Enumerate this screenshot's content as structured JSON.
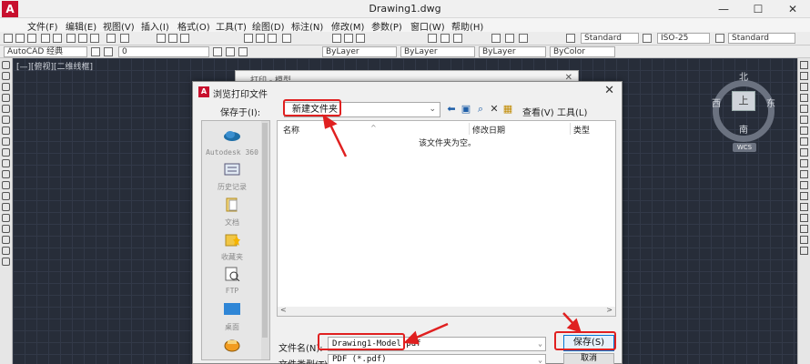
{
  "window": {
    "title": "Drawing1.dwg",
    "logo": "A",
    "minimize": "—",
    "maximize": "☐",
    "close": "✕"
  },
  "menu": [
    "文件(F)",
    "编辑(E)",
    "视图(V)",
    "插入(I)",
    "格式(O)",
    "工具(T)",
    "绘图(D)",
    "标注(N)",
    "修改(M)",
    "参数(P)",
    "窗口(W)",
    "帮助(H)"
  ],
  "toolbar": {
    "text_style": "Standard",
    "dim_style": "ISO-25",
    "table_style": "Standard",
    "workspace": "AutoCAD 经典",
    "layer_value": "0",
    "color": "ByLayer",
    "linetype": "ByLayer",
    "lineweight": "ByLayer",
    "plotstyle": "ByColor"
  },
  "viewport_label": "[—][俯视][二维线框]",
  "viewcube": {
    "top": "上",
    "north": "北",
    "south": "南",
    "east": "东",
    "west": "西",
    "wcs": "WCS"
  },
  "bg_dialog": {
    "title": "打印 - 模型",
    "close": "✕"
  },
  "dialog": {
    "title": "浏览打印文件",
    "close": "✕",
    "save_in_label": "保存于(I):",
    "save_in_value": "新建文件夹",
    "view_menu": "查看(V)",
    "tools_menu": "工具(L)",
    "places": [
      {
        "label": "Autodesk 360",
        "icon": "cloud-icon"
      },
      {
        "label": "历史记录",
        "icon": "history-icon"
      },
      {
        "label": "文档",
        "icon": "documents-icon"
      },
      {
        "label": "收藏夹",
        "icon": "favorites-icon"
      },
      {
        "label": "FTP",
        "icon": "ftp-icon"
      },
      {
        "label": "桌面",
        "icon": "desktop-icon"
      },
      {
        "label": "",
        "icon": "buzzsaw-icon"
      }
    ],
    "columns": [
      "名称",
      "修改日期",
      "类型"
    ],
    "empty_message": "该文件夹为空。",
    "filename_label": "文件名(N):",
    "filename_value": "Drawing1-Model.pdf",
    "filetype_label": "文件类型(T):",
    "filetype_value": "PDF (*.pdf)",
    "save_button": "保存(S)",
    "cancel_button": "取消"
  },
  "colors": {
    "annotation_red": "#e02020",
    "drawing_bg": "#272d39",
    "accent_blue": "#0078d7"
  }
}
